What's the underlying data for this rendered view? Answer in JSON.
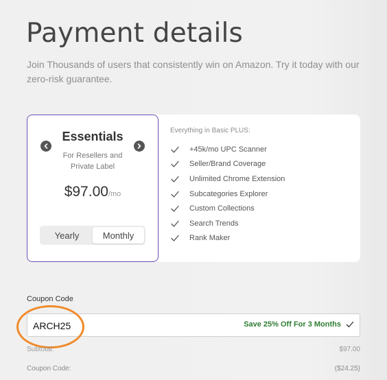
{
  "header": {
    "title": "Payment details",
    "subtitle": "Join Thousands of users that consistently win on Amazon. Try it today with our zero-risk guarantee."
  },
  "plan": {
    "name": "Essentials",
    "description": "For Resellers and Private Label",
    "price": "$97.00",
    "price_unit": "/mo",
    "billing_options": [
      "Yearly",
      "Monthly"
    ],
    "selected_billing": "Monthly"
  },
  "features": {
    "heading": "Everything in Basic PLUS:",
    "items": [
      "+45k/mo UPC Scanner",
      "Seller/Brand Coverage",
      "Unlimited Chrome Extension",
      "Subcategories Explorer",
      "Custom Collections",
      "Search Trends",
      "Rank Maker"
    ]
  },
  "coupon": {
    "label": "Coupon Code",
    "value": "ARCH25",
    "status": "Save 25% Off For 3 Months"
  },
  "summary": {
    "subtotal_label": "Subtotal:",
    "subtotal_value": "$97.00",
    "coupon_label": "Coupon Code:",
    "coupon_value": "($24.25)"
  },
  "colors": {
    "accent_border": "#6a4fb1",
    "success": "#2e7d32",
    "highlight": "#f08a2a"
  }
}
